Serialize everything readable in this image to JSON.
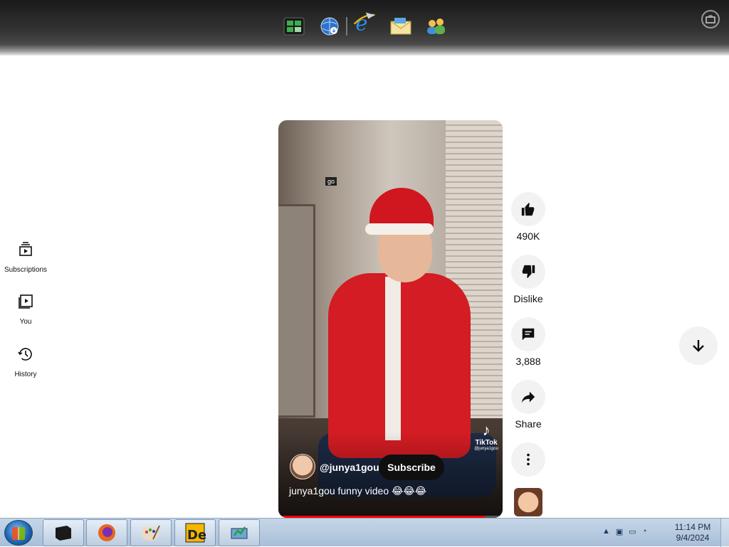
{
  "dock": {
    "items": [
      {
        "name": "media-center-icon",
        "glyph": "▦",
        "color": "#2d8a3e"
      },
      {
        "name": "network-globe-icon",
        "glyph": "◍",
        "color": "#3a7bd5"
      },
      {
        "name": "internet-explorer-icon",
        "glyph": "e",
        "color": "#1e88e5"
      },
      {
        "name": "mail-icon",
        "glyph": "✉",
        "color": "#e9c46a"
      },
      {
        "name": "users-icon",
        "glyph": "☺",
        "color": "#6bb3e8"
      }
    ]
  },
  "sidebar": {
    "items": [
      {
        "id": "subscriptions",
        "label": "Subscriptions"
      },
      {
        "id": "you",
        "label": "You"
      },
      {
        "id": "history",
        "label": "History"
      }
    ]
  },
  "video": {
    "overlay_tag": "go",
    "watermark": "TikTok",
    "watermark_handle": "@junya1gou",
    "channel": "@junya1gou",
    "subscribe_label": "Subscribe",
    "caption": "junya1gou funny video 😂😂😂",
    "progress": 0.92
  },
  "actions": {
    "like_count": "490K",
    "dislike_label": "Dislike",
    "comment_count": "3,888",
    "share_label": "Share"
  },
  "taskbar": {
    "apps": [
      {
        "name": "terminal-app-icon",
        "glyph": "▪"
      },
      {
        "name": "firefox-app-icon",
        "glyph": "◉"
      },
      {
        "name": "paint-app-icon",
        "glyph": "🎨"
      },
      {
        "name": "de-app-icon",
        "glyph": "De"
      },
      {
        "name": "monitor-app-icon",
        "glyph": "▟"
      }
    ],
    "clock_time": "11:14 PM",
    "clock_date": "9/4/2024"
  },
  "colors": {
    "accent_red": "#ff0000",
    "subscribe_bg": "#0f0f0f",
    "action_bg": "#f2f2f2"
  }
}
